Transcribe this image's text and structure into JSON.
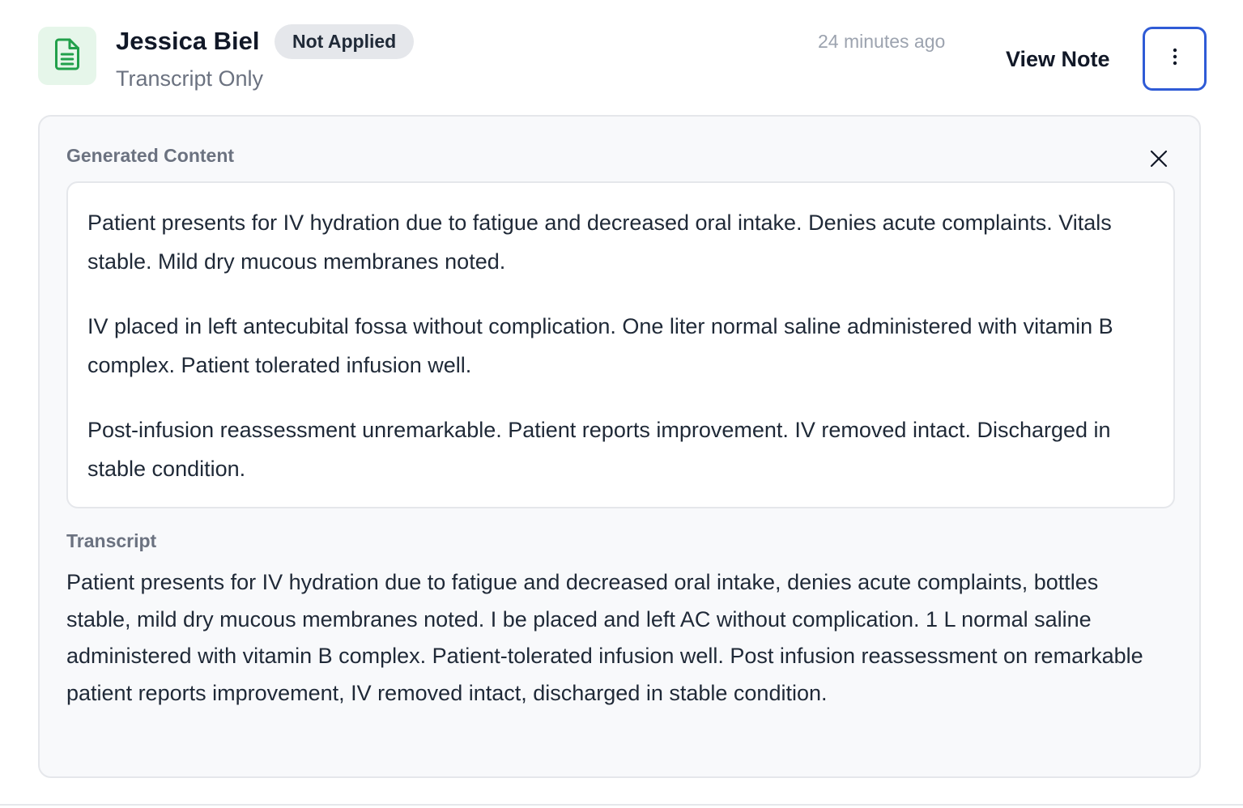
{
  "header": {
    "patient_name": "Jessica Biel",
    "status_badge": "Not Applied",
    "note_type": "Transcript Only",
    "timestamp": "24 minutes ago",
    "view_note_label": "View Note",
    "icons": {
      "file": "file-text-icon",
      "more": "more-vertical-icon"
    }
  },
  "panel": {
    "generated_label": "Generated Content",
    "generated_paragraphs": [
      "Patient presents for IV hydration due to fatigue and decreased oral intake. Denies acute complaints. Vitals stable. Mild dry mucous membranes noted.",
      "IV placed in left antecubital fossa without complication. One liter normal saline administered with vitamin B complex. Patient tolerated infusion well.",
      "Post-infusion reassessment unremarkable. Patient reports improvement. IV removed intact. Discharged in stable condition."
    ],
    "transcript_label": "Transcript",
    "transcript_text": "Patient presents for IV hydration due to fatigue and decreased oral intake, denies acute complaints, bottles stable, mild dry mucous membranes noted. I be placed and left AC without complication. 1 L normal saline administered with vitamin B complex. Patient-tolerated infusion well. Post infusion reassessment on remarkable patient reports improvement, IV removed intact, discharged in stable condition.",
    "close_icon": "close-icon"
  },
  "colors": {
    "accent_border": "#2f5bd6",
    "icon_green": "#22a04b",
    "icon_bg": "#e6f6ea",
    "badge_bg": "#e5e7eb"
  }
}
